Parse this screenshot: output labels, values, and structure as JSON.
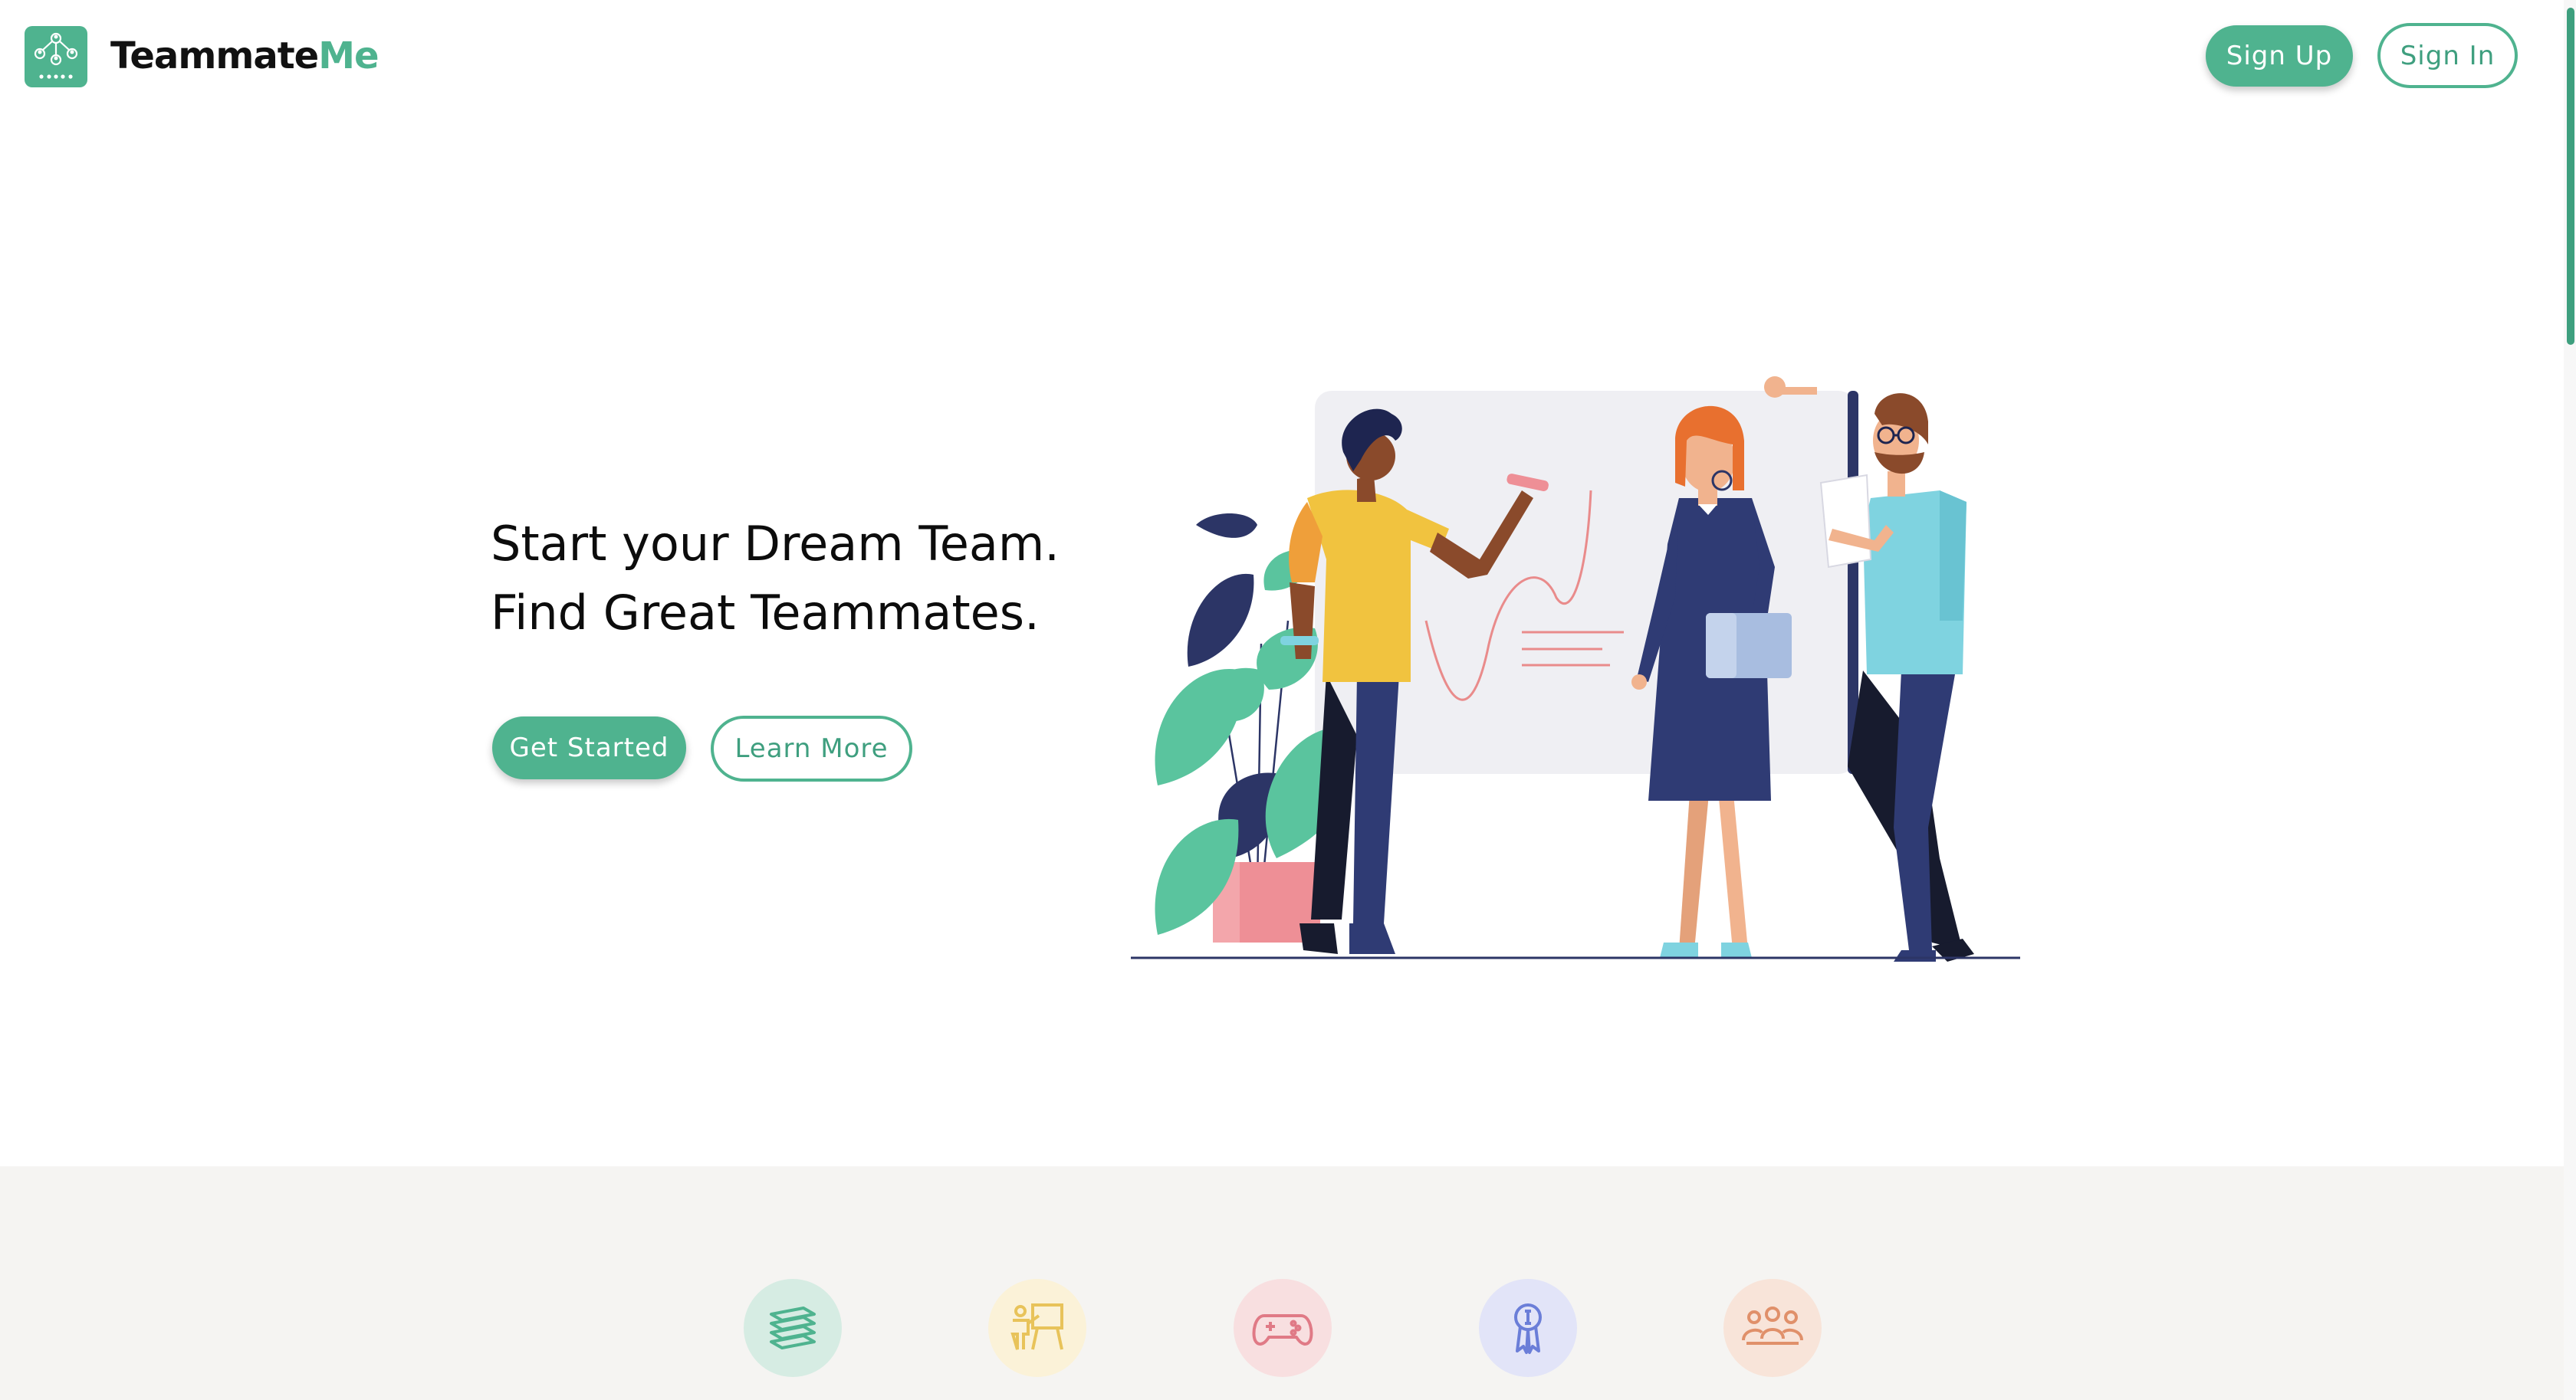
{
  "brand": {
    "name_part1": "Teammate",
    "name_part2": "Me",
    "logo_icon": "team-network-icon",
    "accent_color": "#4fb38f"
  },
  "nav": {
    "sign_up": "Sign Up",
    "sign_in": "Sign In"
  },
  "hero": {
    "line1": "Start your Dream Team.",
    "line2": "Find Great Teammates.",
    "primary_cta": "Get Started",
    "secondary_cta": "Learn More",
    "illustration": "team-whiteboard-illustration"
  },
  "features": {
    "icons": [
      {
        "name": "books-icon",
        "color": "#4fb38f",
        "bg": "#d6ece3"
      },
      {
        "name": "presentation-icon",
        "color": "#e8c35a",
        "bg": "#fbf2d8"
      },
      {
        "name": "gamepad-icon",
        "color": "#e07a86",
        "bg": "#f8dfe0"
      },
      {
        "name": "award-icon",
        "color": "#6b7ed8",
        "bg": "#e2e4f8"
      },
      {
        "name": "group-icon",
        "color": "#e0906a",
        "bg": "#f8e4d9"
      }
    ]
  }
}
